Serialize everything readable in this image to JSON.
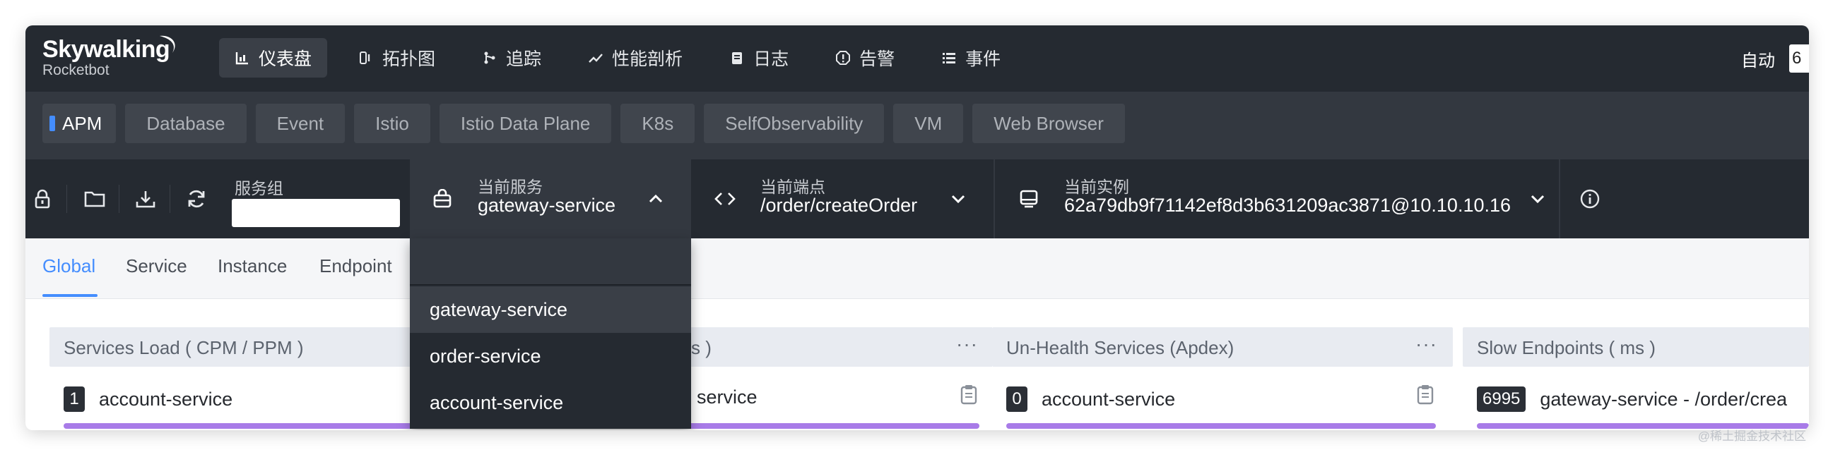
{
  "app": {
    "logo_title": "Skywalking",
    "logo_subtitle": "Rocketbot"
  },
  "nav": {
    "items": [
      {
        "label": "仪表盘",
        "icon": "dashboard-icon",
        "active": true
      },
      {
        "label": "拓扑图",
        "icon": "topology-icon"
      },
      {
        "label": "追踪",
        "icon": "trace-icon"
      },
      {
        "label": "性能剖析",
        "icon": "profile-icon"
      },
      {
        "label": "日志",
        "icon": "log-icon"
      },
      {
        "label": "告警",
        "icon": "alarm-icon"
      },
      {
        "label": "事件",
        "icon": "event-icon"
      }
    ],
    "auto_label": "自动",
    "auto_value": "6"
  },
  "templates": [
    "APM",
    "Database",
    "Event",
    "Istio",
    "Istio Data Plane",
    "K8s",
    "SelfObservability",
    "VM",
    "Web Browser"
  ],
  "toolbar": {
    "service_group_label": "服务组",
    "service_group_value": "",
    "current_service_label": "当前服务",
    "current_service_value": "gateway-service",
    "current_endpoint_label": "当前端点",
    "current_endpoint_value": "/order/createOrder",
    "current_instance_label": "当前实例",
    "current_instance_value": "62a79db9f71142ef8d3b631209ac3871@10.10.10.16",
    "icons": [
      "lock-icon",
      "folder-icon",
      "download-icon",
      "refresh-icon",
      "info-icon"
    ]
  },
  "dashboard_tabs": [
    "Global",
    "Service",
    "Instance",
    "Endpoint"
  ],
  "widgets": [
    {
      "title": "Services Load ( CPM / PPM )",
      "badge": "1",
      "row": "account-service",
      "bar_fraction": 1.0
    },
    {
      "title": "s )",
      "badge": "",
      "row": "service",
      "bar_fraction": 1.0
    },
    {
      "title": "Un-Health Services (Apdex)",
      "badge": "0",
      "row": "account-service",
      "bar_fraction": 1.0
    },
    {
      "title": "Slow Endpoints ( ms )",
      "badge": "6995",
      "row": "gateway-service - /order/crea",
      "bar_fraction": 1.0
    }
  ],
  "dropdown": {
    "search_value": "",
    "options": [
      "gateway-service",
      "order-service",
      "account-service"
    ],
    "selected": "gateway-service"
  },
  "watermark": "@稀土掘金技术社区",
  "colors": {
    "accent": "#448dfe",
    "bar": "#a87be8",
    "dark_bg": "#252a31"
  }
}
